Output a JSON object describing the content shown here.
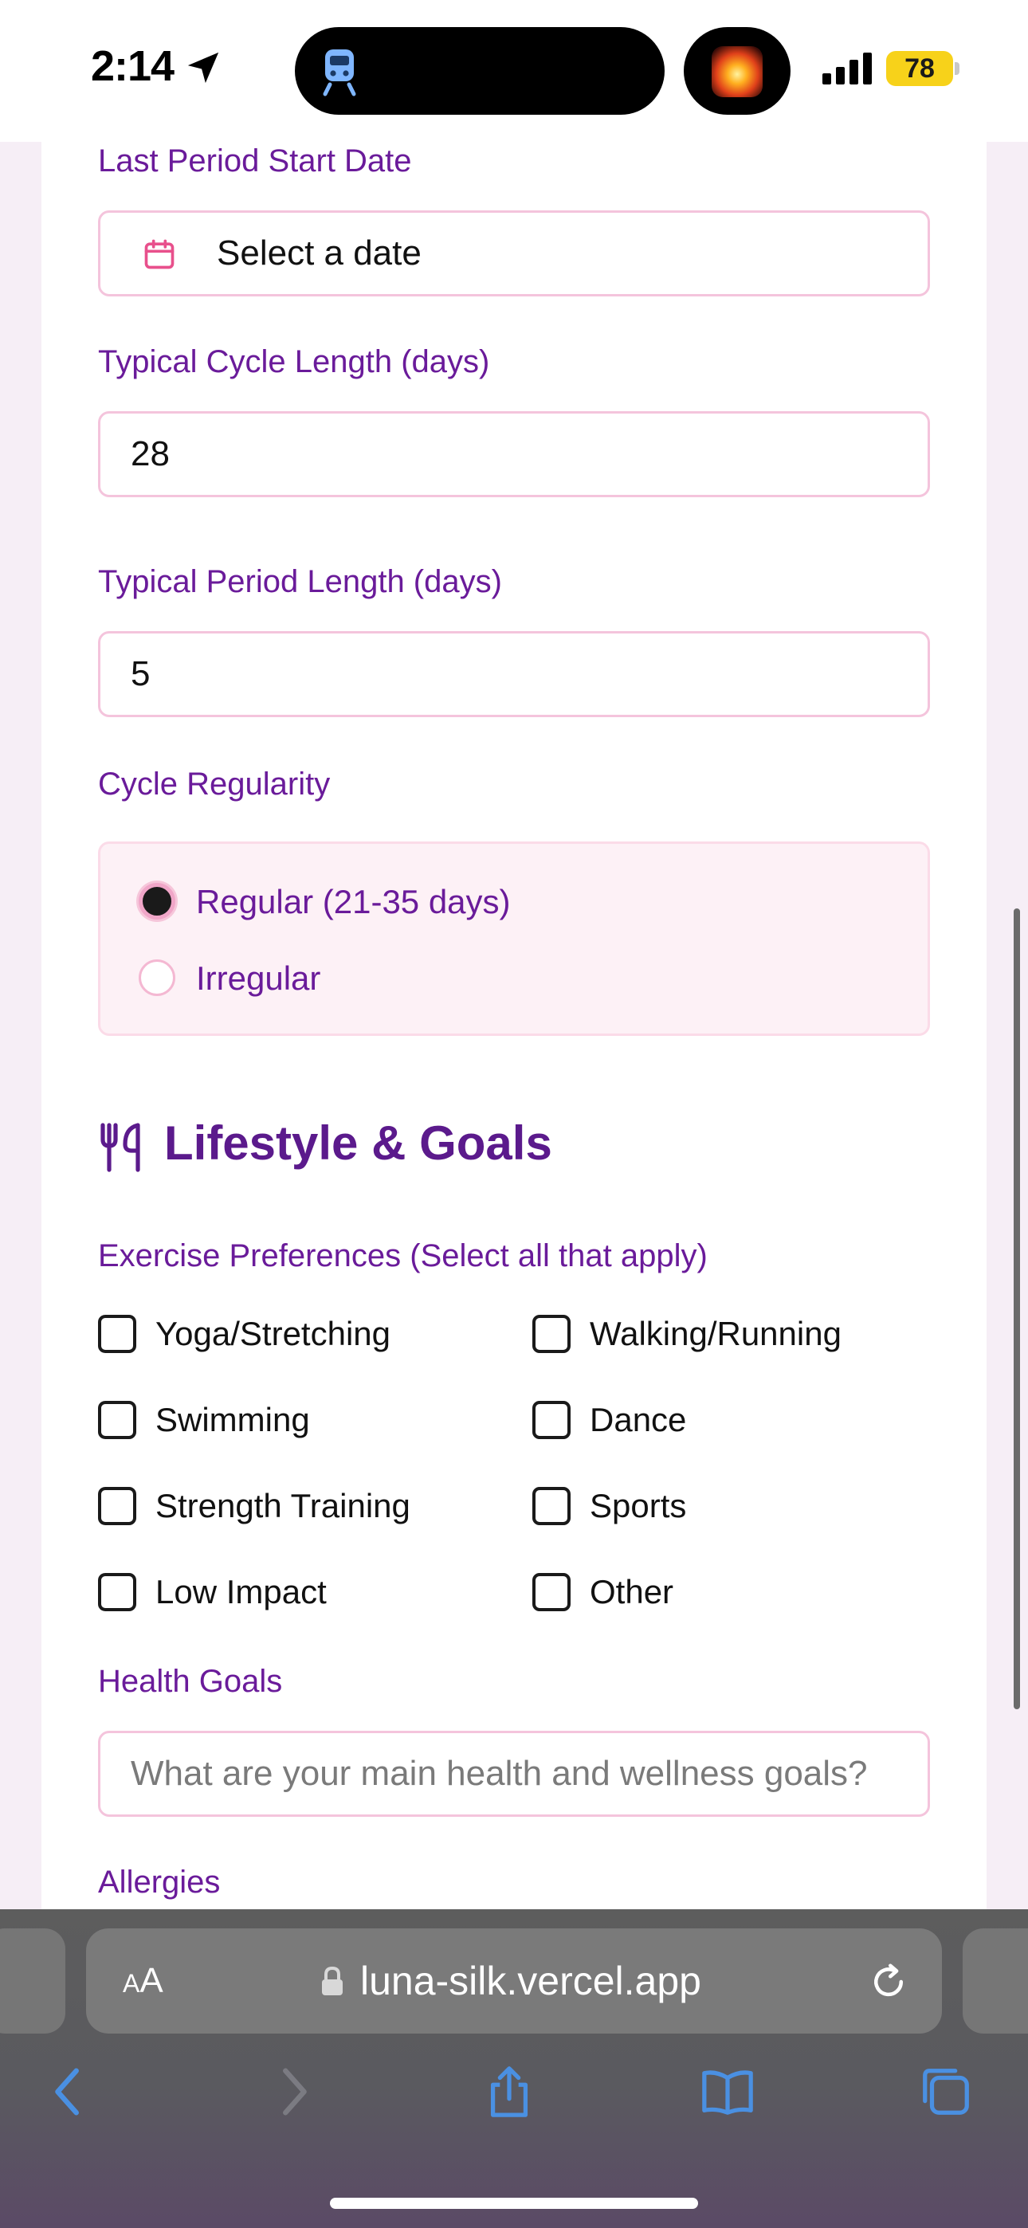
{
  "status_bar": {
    "time": "2:14",
    "battery_level": "78",
    "icons": [
      "location-arrow-icon",
      "train-icon",
      "app-activity-icon",
      "cellular-signal-icon",
      "battery-icon"
    ]
  },
  "form": {
    "last_period": {
      "label": "Last Period Start Date",
      "placeholder": "Select a date",
      "icon": "calendar-icon"
    },
    "cycle_length": {
      "label": "Typical Cycle Length (days)",
      "value": "28"
    },
    "period_length": {
      "label": "Typical Period Length (days)",
      "value": "5"
    },
    "regularity": {
      "label": "Cycle Regularity",
      "options": [
        {
          "label": "Regular (21-35 days)",
          "selected": true
        },
        {
          "label": "Irregular",
          "selected": false
        }
      ]
    }
  },
  "lifestyle": {
    "title": "Lifestyle & Goals",
    "icon": "utensils-icon",
    "exercise_label": "Exercise Preferences (Select all that apply)",
    "exercise_options": [
      "Yoga/Stretching",
      "Walking/Running",
      "Swimming",
      "Dance",
      "Strength Training",
      "Sports",
      "Low Impact",
      "Other"
    ],
    "health_goals": {
      "label": "Health Goals",
      "placeholder": "What are your main health and wellness goals?"
    },
    "allergies_label": "Allergies"
  },
  "browser": {
    "text_size_label": "AA",
    "url": "luna-silk.vercel.app",
    "toolbar_icons": [
      "back-icon",
      "forward-icon",
      "share-icon",
      "bookmarks-icon",
      "tabs-icon"
    ]
  },
  "colors": {
    "label_purple": "#6a1b9a",
    "title_purple": "#5b1a8c",
    "pink_border": "#f4c4dc",
    "safari_blue": "#4a90e2"
  }
}
